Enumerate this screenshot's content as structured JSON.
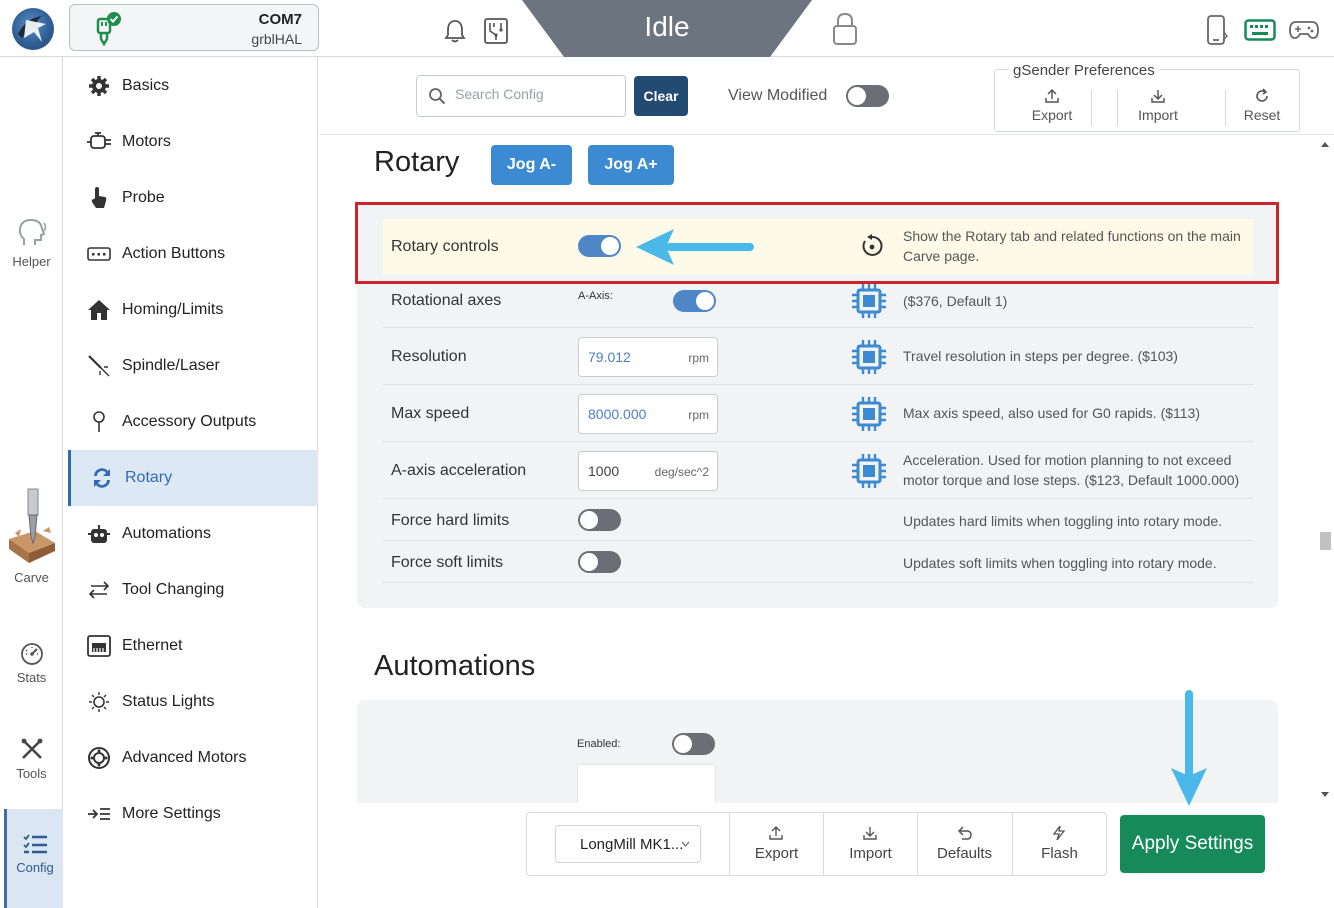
{
  "header": {
    "connection": {
      "port": "COM7",
      "firmware": "grblHAL"
    },
    "machine_state": "Idle",
    "icons": [
      "notification-bell-icon",
      "circuit-board-icon",
      "lock-icon",
      "mobile-icon",
      "keyboard-icon",
      "gamepad-icon"
    ]
  },
  "leftnav": {
    "items": [
      {
        "label": "Helper",
        "icon": "helper-head-icon"
      },
      {
        "label": "Carve",
        "icon": "carve-drill-icon"
      },
      {
        "label": "Stats",
        "icon": "gauge-icon"
      },
      {
        "label": "Tools",
        "icon": "wrench-cross-icon"
      },
      {
        "label": "Config",
        "icon": "checklist-icon"
      }
    ]
  },
  "categories": [
    {
      "label": "Basics",
      "icon": "gear-icon"
    },
    {
      "label": "Motors",
      "icon": "motor-icon"
    },
    {
      "label": "Probe",
      "icon": "hand-pointer-icon"
    },
    {
      "label": "Action Buttons",
      "icon": "keypad-icon"
    },
    {
      "label": "Homing/Limits",
      "icon": "home-icon"
    },
    {
      "label": "Spindle/Laser",
      "icon": "laser-icon"
    },
    {
      "label": "Accessory Outputs",
      "icon": "bulb-icon"
    },
    {
      "label": "Rotary",
      "icon": "rotary-icon",
      "active": true
    },
    {
      "label": "Automations",
      "icon": "robot-icon"
    },
    {
      "label": "Tool Changing",
      "icon": "swap-arrows-icon"
    },
    {
      "label": "Ethernet",
      "icon": "ethernet-icon"
    },
    {
      "label": "Status Lights",
      "icon": "sun-icon"
    },
    {
      "label": "Advanced Motors",
      "icon": "advanced-motor-icon"
    },
    {
      "label": "More Settings",
      "icon": "list-arrow-icon"
    }
  ],
  "toolbar": {
    "search_placeholder": "Search Config",
    "clear_label": "Clear",
    "view_modified_label": "View Modified",
    "prefs_title": "gSender Preferences",
    "export_label": "Export",
    "import_label": "Import",
    "reset_label": "Reset"
  },
  "rotary": {
    "title": "Rotary",
    "jog_minus": "Jog A-",
    "jog_plus": "Jog A+",
    "rows": {
      "controls": {
        "label": "Rotary controls",
        "enabled": true,
        "desc": "Show the Rotary tab and related functions on the main Carve page."
      },
      "axes": {
        "label": "Rotational axes",
        "sub": "A-Axis:",
        "enabled": true,
        "desc": "($376, Default 1)"
      },
      "resolution": {
        "label": "Resolution",
        "value": "79.012",
        "unit": "rpm",
        "desc": "Travel resolution in steps per degree. ($103)"
      },
      "max_speed": {
        "label": "Max speed",
        "value": "8000.000",
        "unit": "rpm",
        "desc": "Max axis speed, also used for G0 rapids. ($113)"
      },
      "accel": {
        "label": "A-axis acceleration",
        "value": "1000",
        "unit": "deg/sec^2",
        "desc": "Acceleration. Used for motion planning to not exceed motor torque and lose steps. ($123, Default 1000.000)"
      },
      "hard": {
        "label": "Force hard limits",
        "enabled": false,
        "desc": "Updates hard limits when toggling into rotary mode."
      },
      "soft": {
        "label": "Force soft limits",
        "enabled": false,
        "desc": "Updates soft limits when toggling into rotary mode."
      }
    }
  },
  "automations": {
    "title": "Automations",
    "enabled_label": "Enabled:",
    "enabled": false
  },
  "bottom": {
    "profile": "LongMill MK1...",
    "export": "Export",
    "import": "Import",
    "defaults": "Defaults",
    "flash": "Flash",
    "apply": "Apply Settings"
  },
  "colors": {
    "accent": "#3c8ad1",
    "apply": "#178a59",
    "highlight_border": "#c8262c",
    "callout_arrow": "#4ab8e8"
  }
}
